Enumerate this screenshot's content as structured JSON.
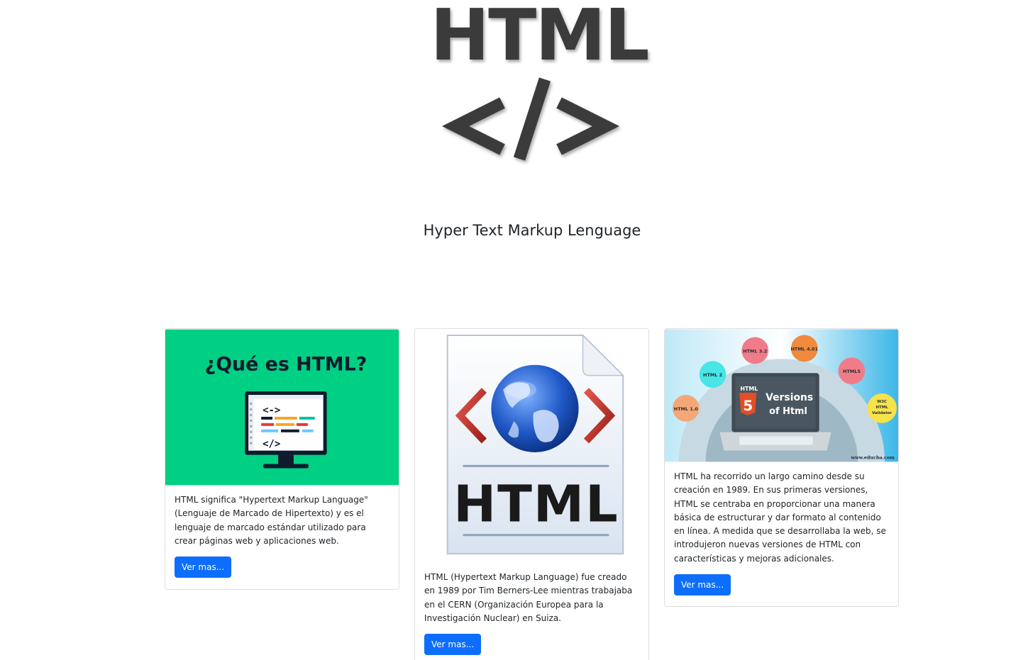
{
  "hero": {
    "logo_text": "HTML",
    "logo_tag": "</>",
    "subtitle": "Hyper Text Markup Lenguage"
  },
  "cards": [
    {
      "image_title": "¿Qué es HTML?",
      "image_icon": "code-monitor-illustration",
      "text": "HTML significa \"Hypertext Markup Language\" (Lenguaje de Marcado de Hipertexto) y es el lenguaje de marcado estándar utilizado para crear páginas web y aplicaciones web.",
      "button": "Ver mas..."
    },
    {
      "image_title": "HTML",
      "image_icon": "html-document-globe-icon",
      "text": "HTML (Hypertext Markup Language) fue creado en 1989 por Tim Berners-Lee mientras trabajaba en el CERN (Organización Europea para la Investigación Nuclear) en Suiza.",
      "button": "Ver mas..."
    },
    {
      "image_title_line1": "Versions",
      "image_title_line2": "of Html",
      "image_badge": "HTML",
      "image_version_bubbles": [
        "HTML 1.0",
        "HTML 2",
        "HTML 3.2",
        "HTML 4.01",
        "HTML5",
        "W3C HTML Validator"
      ],
      "image_credit": "www.educba.com",
      "text": "HTML ha recorrido un largo camino desde su creación en 1989. En sus primeras versiones, HTML se centraba en proporcionar una manera básica de estructurar y dar formato al contenido en línea. A medida que se desarrollaba la web, se introdujeron nuevas versiones de HTML con características y mejoras adicionales.",
      "button": "Ver mas..."
    }
  ],
  "colors": {
    "button": "#0d6efd",
    "card1_bg": "#00d084",
    "logo_dark": "#3b3b3b"
  }
}
